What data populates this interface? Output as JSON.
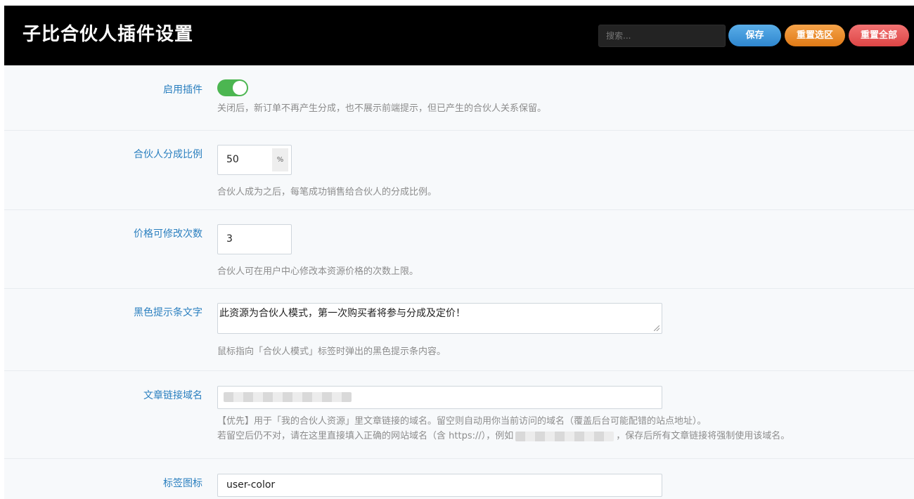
{
  "header": {
    "title": "子比合伙人插件设置",
    "search_placeholder": "搜索...",
    "save_label": "保存",
    "reset_section_label": "重置选区",
    "reset_all_label": "重置全部"
  },
  "fields": {
    "enable": {
      "label": "启用插件",
      "state": "on",
      "desc": "关闭后，新订单不再产生分成，也不展示前端提示，但已产生的合伙人关系保留。"
    },
    "ratio": {
      "label": "合伙人分成比例",
      "value": "50",
      "unit": "%",
      "desc": "合伙人成为之后，每笔成功销售给合伙人的分成比例。"
    },
    "edit_count": {
      "label": "价格可修改次数",
      "value": "3",
      "desc": "合伙人可在用户中心修改本资源价格的次数上限。"
    },
    "tooltip_text": {
      "label": "黑色提示条文字",
      "value": "此资源为合伙人模式，第一次购买者将参与分成及定价！",
      "desc": "鼠标指向「合伙人模式」标签时弹出的黑色提示条内容。"
    },
    "domain": {
      "label": "文章链接域名",
      "desc_line1": "【优先】用于「我的合伙人资源」里文章链接的域名。留空则自动用你当前访问的域名（覆盖后台可能配错的站点地址）。",
      "desc_line2_a": "若留空后仍不对，请在这里直接填入正确的网站域名（含 https://），例如",
      "desc_line2_b": "，保存后所有文章链接将强制使用该域名。"
    },
    "tag_icon": {
      "label": "标签图标",
      "value": "user-color"
    }
  },
  "colors": {
    "header_bg": "#000000",
    "label": "#2a7fbf",
    "toggle_on": "#4cb651",
    "save": "#2e86cf",
    "reset_section": "#e07a16",
    "reset_all": "#dd4545"
  }
}
